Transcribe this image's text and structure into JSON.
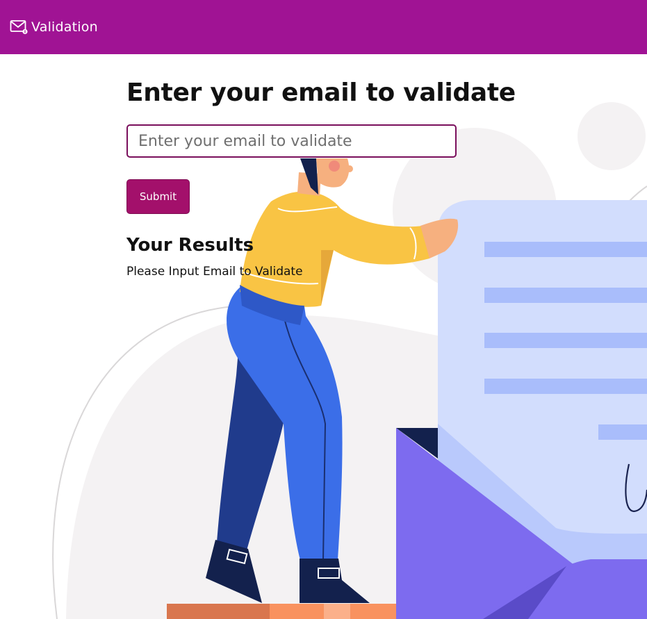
{
  "navbar": {
    "brand_label": "Validation",
    "brand_icon": "envelope-icon",
    "color": "#a01394"
  },
  "main": {
    "heading": "Enter your email to validate",
    "email_input": {
      "value": "",
      "placeholder": "Enter your email to validate"
    },
    "submit_label": "Submit",
    "results": {
      "heading": "Your Results",
      "message": "Please Input Email to Validate"
    }
  },
  "colors": {
    "navbar": "#a01394",
    "submit_button": "#a3106b",
    "input_border": "#7a0f5c"
  }
}
